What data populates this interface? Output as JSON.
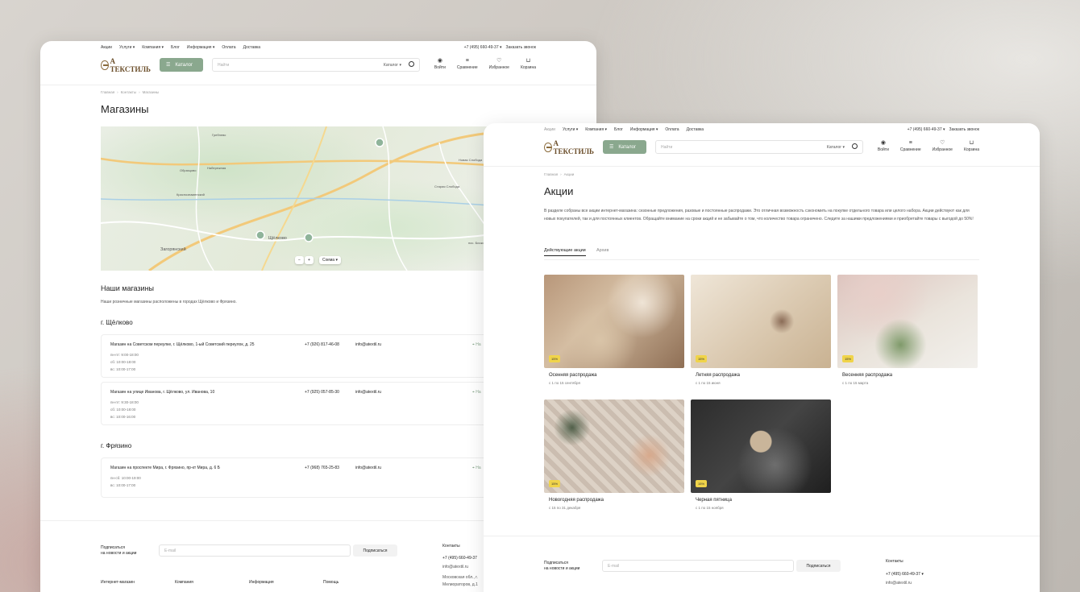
{
  "nav": {
    "items": [
      "Акции",
      "Услуги ▾",
      "Компания ▾",
      "Блог",
      "Информация ▾",
      "Оплата",
      "Доставка"
    ],
    "phone": "+7 (495) 660-49-37 ▾",
    "callback": "Заказать звонок"
  },
  "header": {
    "logo": "А ТЕКСТИЛЬ",
    "catalog": "Каталог",
    "search_placeholder": "Найти",
    "search_cat": "Каталог ▾",
    "icons": [
      {
        "label": "Войти",
        "icon": "user-icon"
      },
      {
        "label": "Сравнение",
        "icon": "compare-icon"
      },
      {
        "label": "Избранное",
        "icon": "heart-icon"
      },
      {
        "label": "Корзина",
        "icon": "cart-icon"
      }
    ]
  },
  "back": {
    "crumbs": [
      "Главная",
      "Контакты",
      "Магазины"
    ],
    "title": "Магазины",
    "map": {
      "labels": [
        "Гребнево",
        "Образцово",
        "Набережная",
        "Краснознаменский",
        "Загорянский",
        "Щёлково",
        "Старая Слобода",
        "Новая Слобода",
        "пос. Биокомбината"
      ],
      "zoom_minus": "−",
      "zoom_plus": "+",
      "scheme": "Схема ▾"
    },
    "our_shops": "Наши магазины",
    "our_shops_desc": "Наши розничные магазины расположены в городах Щёлково и Фрязино.",
    "cities": [
      {
        "name": "г. Щёлково",
        "shops": [
          {
            "name": "Магазин на Советском переулке, г. Щёлково, 1-ый Советский переулок, д. 25",
            "hours": [
              "пн-пт: 9:00-18:00",
              "сб: 10:00-18:00",
              "вс: 10:00-17:00"
            ],
            "phone": "+7 (926) 817-46-08",
            "email": "info@atextil.ru",
            "more": "На"
          },
          {
            "name": "Магазин на улице Иванова, г. Щёлково, ул. Иванова, 10",
            "hours": [
              "пн-пт: 9:30-18:00",
              "сб: 10:00-18:00",
              "вс: 10:00-16:00"
            ],
            "phone": "+7 (925) 057-85-30",
            "email": "info@atextil.ru",
            "more": "На"
          }
        ]
      },
      {
        "name": "г. Фрязино",
        "shops": [
          {
            "name": "Магазин на проспекте Мира, г. Фрязино, пр-кт Мира, д. 6 Б",
            "hours": [
              "пн-сб: 10:00-19:00",
              "вс: 10:00-17:00"
            ],
            "phone": "+7 (968) 765-25-83",
            "email": "info@atextil.ru",
            "more": "На"
          }
        ]
      }
    ],
    "footer": {
      "subscribe": "Подписаться\nна новости и акции",
      "email_placeholder": "E-mail",
      "subscribe_btn": "Подписаться",
      "contacts": "Контакты",
      "phone": "+7 (495) 660-49-37",
      "email": "info@atextil.ru",
      "address": "Московская обл., г.\nМелиораторов, д.1",
      "cols": [
        "Интернет-магазин",
        "Компания",
        "Информация",
        "Помощь"
      ]
    }
  },
  "front": {
    "crumbs": [
      "Главная",
      "Акции"
    ],
    "title": "Акции",
    "desc": "В разделе собраны все акции интернет-магазина: сезонные предложения, разовые и постоянные распродажи. Это отличная возможность сэкономить на покупке отдельного товара или целого набора. Акции действуют как для новых покупателей, так и для постоянных клиентов. Обращайте внимание на сроки акций и не забывайте о том, что количество товара ограничено. Следите за нашими предложениями и приобретайте товары с выгодой до 50%!",
    "tabs": [
      "Действующие акции",
      "Архив"
    ],
    "promos": [
      {
        "title": "Осенняя распродажа",
        "dates": "с 1 по 15 сентября",
        "badge": "15%"
      },
      {
        "title": "Летняя распродажа",
        "dates": "с 1 по 15 июня",
        "badge": "15%"
      },
      {
        "title": "Весенняя распродажа",
        "dates": "с 1 по 15 марта",
        "badge": "15%"
      },
      {
        "title": "Новогодняя распродажа",
        "dates": "с 15 по 31 декабря",
        "badge": "15%"
      },
      {
        "title": "Черная пятница",
        "dates": "с 1 по 15 ноября",
        "badge": "15%"
      }
    ],
    "footer": {
      "subscribe": "Подписаться\nна новости и акции",
      "email_placeholder": "E-mail",
      "subscribe_btn": "Подписаться",
      "contacts": "Контакты",
      "phone": "+7 (495) 660-49-37 ▾",
      "email": "info@atextil.ru"
    }
  }
}
